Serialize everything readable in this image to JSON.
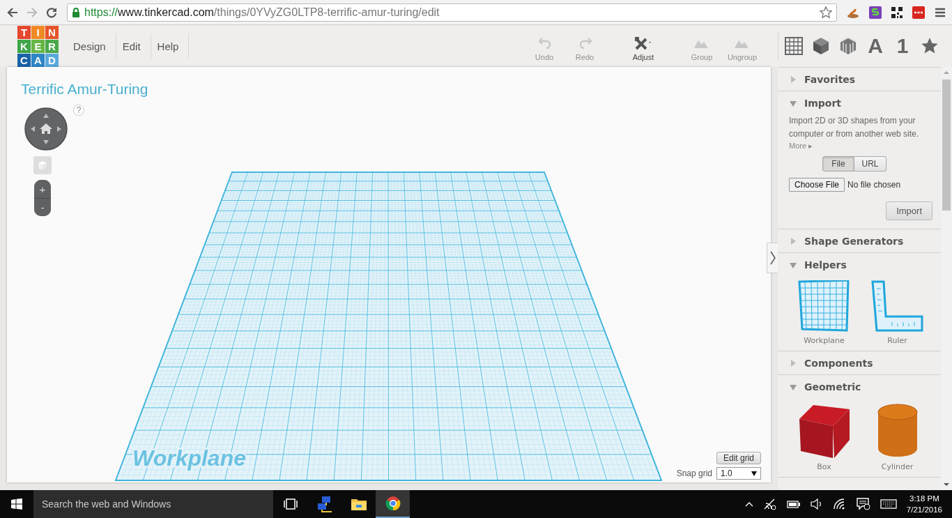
{
  "browser": {
    "url_scheme": "https://",
    "url_host": "www.tinkercad.com",
    "url_path": "/things/0YVyZG0LTP8-terrific-amur-turing/edit"
  },
  "header": {
    "logo": [
      {
        "letter": "T",
        "color": "#e5472e"
      },
      {
        "letter": "I",
        "color": "#f08a24"
      },
      {
        "letter": "N",
        "color": "#e8542c"
      },
      {
        "letter": "K",
        "color": "#3fa548"
      },
      {
        "letter": "E",
        "color": "#66b644"
      },
      {
        "letter": "R",
        "color": "#4aa94a"
      },
      {
        "letter": "C",
        "color": "#1a62a8"
      },
      {
        "letter": "A",
        "color": "#2b86c6"
      },
      {
        "letter": "D",
        "color": "#5aa9dd"
      }
    ],
    "menu": [
      "Design",
      "Edit",
      "Help"
    ],
    "toolbar": [
      {
        "kind": "undo",
        "label": "Undo",
        "disabled": true
      },
      {
        "kind": "redo",
        "label": "Redo",
        "disabled": true
      },
      {
        "kind": "adjust",
        "label": "Adjust",
        "disabled": false
      },
      {
        "kind": "group",
        "label": "Group",
        "disabled": true
      },
      {
        "kind": "ungroup",
        "label": "Ungroup",
        "disabled": true
      }
    ],
    "library_tabs": [
      {
        "kind": "grid"
      },
      {
        "kind": "cube"
      },
      {
        "kind": "pattern-cube"
      },
      {
        "kind": "text",
        "label": "A"
      },
      {
        "kind": "text",
        "label": "1"
      },
      {
        "kind": "star"
      }
    ]
  },
  "canvas": {
    "title": "Terrific Amur-Turing",
    "help": "?",
    "zoom_in": "+",
    "zoom_out": "-",
    "workplane_label": "Workplane",
    "edit_grid": "Edit grid",
    "snap_label": "Snap grid",
    "snap_value": "1.0"
  },
  "sidebar": {
    "sections": [
      {
        "title": "Favorites",
        "expanded": false
      },
      {
        "title": "Import",
        "expanded": true,
        "import": {
          "description": "Import 2D or 3D shapes from your computer or from another web site.",
          "more": "More ▸",
          "modes": [
            {
              "label": "File",
              "selected": true
            },
            {
              "label": "URL",
              "selected": false
            }
          ],
          "choose_file": "Choose File",
          "file_status": "No file chosen",
          "button": "Import"
        }
      },
      {
        "title": "Shape Generators",
        "expanded": false
      },
      {
        "title": "Helpers",
        "expanded": true,
        "items": [
          {
            "kind": "workplane",
            "label": "Workplane"
          },
          {
            "kind": "ruler",
            "label": "Ruler"
          }
        ]
      },
      {
        "title": "Components",
        "expanded": false
      },
      {
        "title": "Geometric",
        "expanded": true,
        "items": [
          {
            "kind": "box",
            "label": "Box"
          },
          {
            "kind": "cylinder",
            "label": "Cylinder"
          }
        ]
      }
    ]
  },
  "taskbar": {
    "search": {
      "placeholder": "Search the web and Windows"
    },
    "apps": [
      {
        "kind": "task-view",
        "selected": false
      },
      {
        "kind": "network",
        "selected": false
      },
      {
        "kind": "folder",
        "selected": false
      },
      {
        "kind": "browser",
        "selected": true
      }
    ],
    "time": "3:18 PM",
    "date": "7/21/2016"
  }
}
